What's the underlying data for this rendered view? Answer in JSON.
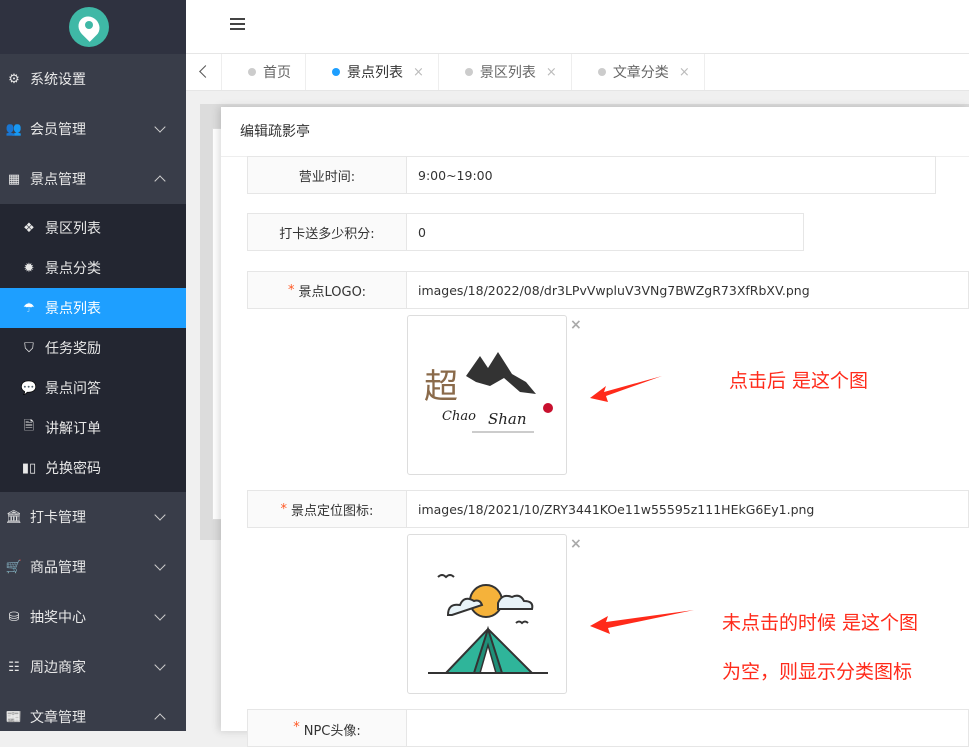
{
  "sidebar": {
    "items": [
      {
        "label": "系统设置",
        "icon": "gears-icon"
      },
      {
        "label": "会员管理",
        "icon": "users-icon"
      },
      {
        "label": "景点管理",
        "icon": "grid-icon"
      }
    ],
    "sub_items": [
      {
        "label": "景区列表",
        "icon": "cubes-icon"
      },
      {
        "label": "景点分类",
        "icon": "gear-icon"
      },
      {
        "label": "景点列表",
        "icon": "umbrella-icon"
      },
      {
        "label": "任务奖励",
        "icon": "shield-icon"
      },
      {
        "label": "景点问答",
        "icon": "chat-icon"
      },
      {
        "label": "讲解订单",
        "icon": "audio-file-icon"
      },
      {
        "label": "兑换密码",
        "icon": "barcode-icon"
      }
    ],
    "items_after": [
      {
        "label": "打卡管理",
        "icon": "bank-icon"
      },
      {
        "label": "商品管理",
        "icon": "cart-icon"
      },
      {
        "label": "抽奖中心",
        "icon": "database-icon"
      },
      {
        "label": "周边商家",
        "icon": "sitemap-icon"
      },
      {
        "label": "文章管理",
        "icon": "newspaper-icon"
      }
    ]
  },
  "tabs": [
    {
      "label": "首页"
    },
    {
      "label": "景点列表",
      "close": "×"
    },
    {
      "label": "景区列表",
      "close": "×"
    },
    {
      "label": "文章分类",
      "close": "×"
    }
  ],
  "modal": {
    "title": "编辑疏影亭",
    "fields": {
      "hours": {
        "label": "营业时间:",
        "value": "9:00~19:00"
      },
      "points": {
        "label": "打卡送多少积分:",
        "value": "0"
      },
      "logo": {
        "required": "*",
        "label": "景点LOGO:",
        "value": "images/18/2022/08/dr3LPvVwpluV3VNg7BWZgR73XfRbXV.png"
      },
      "marker": {
        "required": "*",
        "label": "景点定位图标:",
        "value": "images/18/2021/10/ZRY3441KOe11w55595z111HEkG6Ey1.png"
      },
      "npc": {
        "required": "*",
        "label": "NPC头像:"
      }
    },
    "delete_symbol": "×",
    "logo_image_text": {
      "cn": "超",
      "en1": "Chao",
      "en2": "Shan"
    }
  },
  "annotations": {
    "after_click": "点击后 是这个图",
    "before_click": "未点击的时候 是这个图",
    "empty_note": "为空，则显示分类图标"
  },
  "colors": {
    "sidebar_bg": "#393d49",
    "active": "#1e9fff",
    "annotation": "#ff2a1a",
    "required": "#ff5722",
    "logo_teal": "#3fb8a6"
  }
}
